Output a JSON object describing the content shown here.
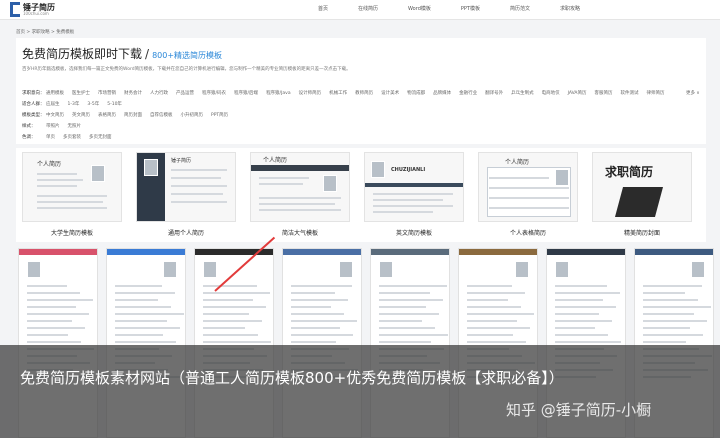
{
  "logo": {
    "name": "锤子简历",
    "domain": "100chui.com"
  },
  "nav": [
    "首页",
    "在线简历",
    "Word模板",
    "PPT模板",
    "简历范文",
    "求职攻略"
  ],
  "breadcrumb": "首页 > 求职攻略 > 免费模板",
  "header": {
    "title": "免费简历模板即时下载",
    "subtitle": "800+精选简历模板",
    "intro": "百岁HR历年甄选模板，选择我们每一篇正文免费的Word简历模板，下载并在您自己的计算机进行编辑，您与制作一个精美的专业简历模板的距离只差一次点击下载。"
  },
  "filters": [
    {
      "label": "求职意向：",
      "options": [
        "通用模板",
        "医生护士",
        "市场营销",
        "财务会计",
        "人力行政",
        "产品运营",
        "程序猿/码农",
        "程序猿/后端",
        "程序猿/Java",
        "设计师简历",
        "机械工作",
        "教师简历",
        "设计美术",
        "物流成都",
        "品牌媒体",
        "金融行业",
        "翻译号外",
        "乒乓生制式",
        "电商地仅",
        "JAVA简历",
        "客服简历",
        "软件测试",
        "律师简历"
      ],
      "more": "更多 ∨"
    },
    {
      "label": "适合人群：",
      "options": [
        "应届生",
        "1-3年",
        "3-5年",
        "5-10年"
      ]
    },
    {
      "label": "模板类型：",
      "options": [
        "中文简历",
        "英文简历",
        "表格简历",
        "简历封面",
        "自荐信模板",
        "小升初简历",
        "PPT简历"
      ]
    },
    {
      "label": "样式：",
      "options": [
        "带照片",
        "无照片"
      ]
    },
    {
      "label": "色调：",
      "options": [
        "单页",
        "多页套装",
        "多页无封面"
      ]
    }
  ],
  "category_cards": [
    {
      "caption": "大学生简历模板"
    },
    {
      "caption": "通用个人简历"
    },
    {
      "caption": "简洁大气模板"
    },
    {
      "caption": "英文简历模板"
    },
    {
      "caption": "个人表格简历"
    },
    {
      "caption": "精美简历封面"
    }
  ],
  "card_thumb_text": {
    "resume": "个人简历",
    "resume2": "锤子简历",
    "english": "CHUZIJIANLI",
    "cover": "求职简历"
  },
  "overlay": {
    "title": "免费简历模板素材网站（普通工人简历模板800+优秀免费简历模板【求职必备】）",
    "watermark": "知乎 @锤子简历-小橱"
  },
  "colors": {
    "accent": "#2a87d8",
    "brand": "#2c5fa8",
    "arrow": "#e23b3b",
    "overlay": "#373737"
  }
}
